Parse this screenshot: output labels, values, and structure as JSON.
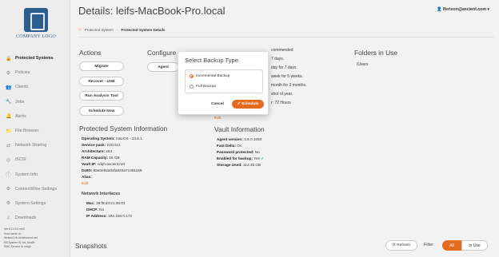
{
  "sidebar": {
    "logo_text": "COMPANY LOGO",
    "items": [
      {
        "label": "Protected Systems",
        "icon": "lock-icon",
        "glyph": "🔒",
        "active": true
      },
      {
        "label": "Policies",
        "icon": "gear-icon",
        "glyph": "⚙"
      },
      {
        "label": "Clients",
        "icon": "users-icon",
        "glyph": "👥"
      },
      {
        "label": "Jobs",
        "icon": "wrench-icon",
        "glyph": "🔧"
      },
      {
        "label": "Alerts",
        "icon": "bell-icon",
        "glyph": "🔔"
      },
      {
        "label": "File Browser",
        "icon": "folder-icon",
        "glyph": "📁"
      },
      {
        "label": "Network Sharing",
        "icon": "share-icon",
        "glyph": "⇄"
      },
      {
        "label": "iSCSI",
        "icon": "disk-icon",
        "glyph": "◎"
      },
      {
        "label": "System Info",
        "icon": "info-icon",
        "glyph": "ⓘ"
      },
      {
        "label": "ConnectWise Settings",
        "icon": "cog-icon",
        "glyph": "⚙"
      },
      {
        "label": "System Settings",
        "icon": "settings-icon",
        "glyph": "⚙"
      },
      {
        "label": "Downloads",
        "icon": "download-icon",
        "glyph": "⇩"
      }
    ],
    "footer": [
      "Ver 6.12.0.0 mb2",
      "Host name: rb-",
      "lfertson1.rb.att.afixcloud.net",
      "RB System ID: bd_61a69",
      "RMC Service id: cdtgh"
    ]
  },
  "header": {
    "title": "Details: leifs-MacBook-Pro.local",
    "user": "lfertson@axcient.com"
  },
  "breadcrumb": {
    "parent": "Protected System",
    "current": "Protected System Details"
  },
  "actions": {
    "heading": "Actions",
    "migrate": "Migrate",
    "recover": "Recover - USB",
    "run_analysis": "Run Analysis Tool",
    "schedule_now": "Schedule Now"
  },
  "configure": {
    "heading": "Configure",
    "agent_button": "Agent"
  },
  "schedule_fragments": {
    "line1": "commended",
    "line2": "7 days.",
    "line3": "day for 7 days.",
    "line4": "week for 5 weeks.",
    "line5": "month for 3 months.",
    "line6": "shot of year.",
    "line7": "r: 72 Hours"
  },
  "folders": {
    "heading": "Folders in Use",
    "path": "/Users"
  },
  "protected_info": {
    "heading": "Protected System Information",
    "os_label": "Operating System:",
    "os_value": "macOS - 13.6.1",
    "sp_label": "Service pack:",
    "sp_value": "22G313",
    "arch_label": "Architecture:",
    "arch_value": "x64",
    "ram_label": "RAM Capacity:",
    "ram_value": "16 GB",
    "vault_label": "Vault IP:",
    "vault_value": "cdqh.axcient.net",
    "guid_label": "GUID:",
    "guid_value": "65e0e92a04fa020a71351199",
    "alias_label": "Alias:",
    "alias_value": "",
    "edit": "Edit"
  },
  "network": {
    "heading": "Network Interfaces",
    "mac_label": "Mac:",
    "mac_value": "38:f9:d3:21:36:03",
    "dhcp_label": "DHCP:",
    "dhcp_value": "No",
    "ip_label": "IP Address:",
    "ip_value": "192.168.0.172"
  },
  "vault_info": {
    "heading": "Vault Information",
    "edit": "Edit",
    "agent_label": "Agent version:",
    "agent_value": "3.6.0.1050",
    "fast_label": "Fast Delta:",
    "fast_value": "On",
    "pwd_label": "Password protected:",
    "pwd_value": "No",
    "enabled_label": "Enabled for backup:",
    "enabled_value": "Yes",
    "storage_label": "Storage Used:",
    "storage_value": "112.45 GB"
  },
  "bottom": {
    "snapshots": "Snapshots",
    "refresh": "Refresh",
    "filter": "Filter",
    "all": "All",
    "in_use": "In Use"
  },
  "modal": {
    "title": "Select Backup Type",
    "option_incremental": "Incremental Backup",
    "option_full": "Full Backup",
    "cancel": "Cancel",
    "schedule": "Schedule"
  },
  "colors": {
    "accent": "#e46b1d",
    "enabled_check": "#3aa655"
  }
}
